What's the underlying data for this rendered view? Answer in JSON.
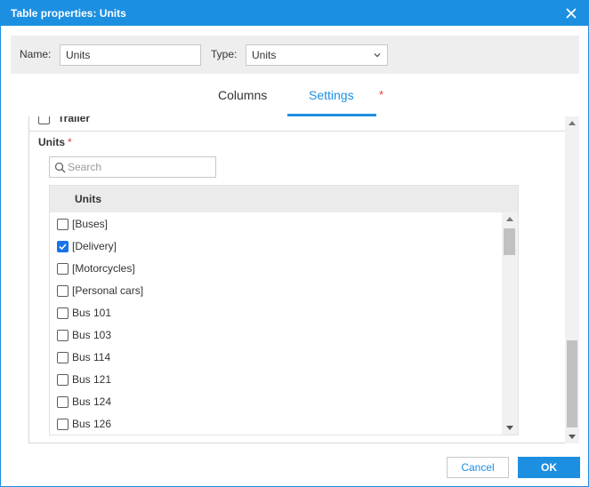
{
  "dialog": {
    "title": "Table properties: Units",
    "accent_color": "#1d8fe1"
  },
  "topbar": {
    "name_label": "Name:",
    "name_value": "Units",
    "type_label": "Type:",
    "type_value": "Units"
  },
  "tabs": [
    {
      "label": "Columns",
      "active": false
    },
    {
      "label": "Settings",
      "active": true
    }
  ],
  "required_marker": "*",
  "content": {
    "trailer_label": "Trailer",
    "units_heading": "Units",
    "search_placeholder": "Search",
    "list_header": "Units",
    "items": [
      {
        "label": "[Buses]",
        "checked": false
      },
      {
        "label": "[Delivery]",
        "checked": true
      },
      {
        "label": "[Motorcycles]",
        "checked": false
      },
      {
        "label": "[Personal cars]",
        "checked": false
      },
      {
        "label": "Bus 101",
        "checked": false
      },
      {
        "label": "Bus 103",
        "checked": false
      },
      {
        "label": "Bus 114",
        "checked": false
      },
      {
        "label": "Bus 121",
        "checked": false
      },
      {
        "label": "Bus 124",
        "checked": false
      },
      {
        "label": "Bus 126",
        "checked": false
      }
    ]
  },
  "buttons": {
    "cancel": "Cancel",
    "ok": "OK"
  }
}
